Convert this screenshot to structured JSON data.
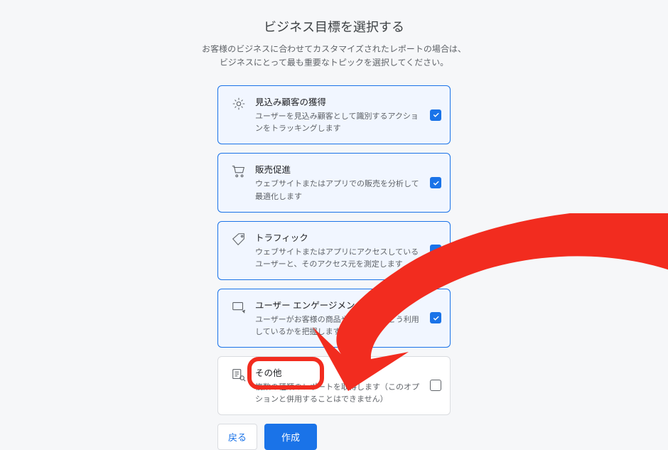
{
  "header": {
    "title": "ビジネス目標を選択する",
    "subtitle_line1": "お客様のビジネスに合わせてカスタマイズされたレポートの場合は、",
    "subtitle_line2": "ビジネスにとって最も重要なトピックを選択してください。"
  },
  "options": [
    {
      "icon": "lead-icon",
      "title": "見込み顧客の獲得",
      "desc": "ユーザーを見込み顧客として識別するアクションをトラッキングします",
      "selected": true
    },
    {
      "icon": "cart-icon",
      "title": "販売促進",
      "desc": "ウェブサイトまたはアプリでの販売を分析して最適化します",
      "selected": true
    },
    {
      "icon": "tag-icon",
      "title": "トラフィック",
      "desc": "ウェブサイトまたはアプリにアクセスしているユーザーと、そのアクセス元を測定します",
      "selected": true
    },
    {
      "icon": "engagement-icon",
      "title": "ユーザー エンゲージメントと維持率",
      "desc": "ユーザーがお客様の商品やサービスをどう利用しているかを把握します",
      "selected": true
    },
    {
      "icon": "other-icon",
      "title": "その他",
      "desc": "複数の種類のレポートを取得します（このオプションと併用することはできません）",
      "selected": false
    }
  ],
  "footer": {
    "back_label": "戻る",
    "create_label": "作成"
  },
  "colors": {
    "accent": "#1a73e8",
    "annotation": "#f22c1f"
  }
}
